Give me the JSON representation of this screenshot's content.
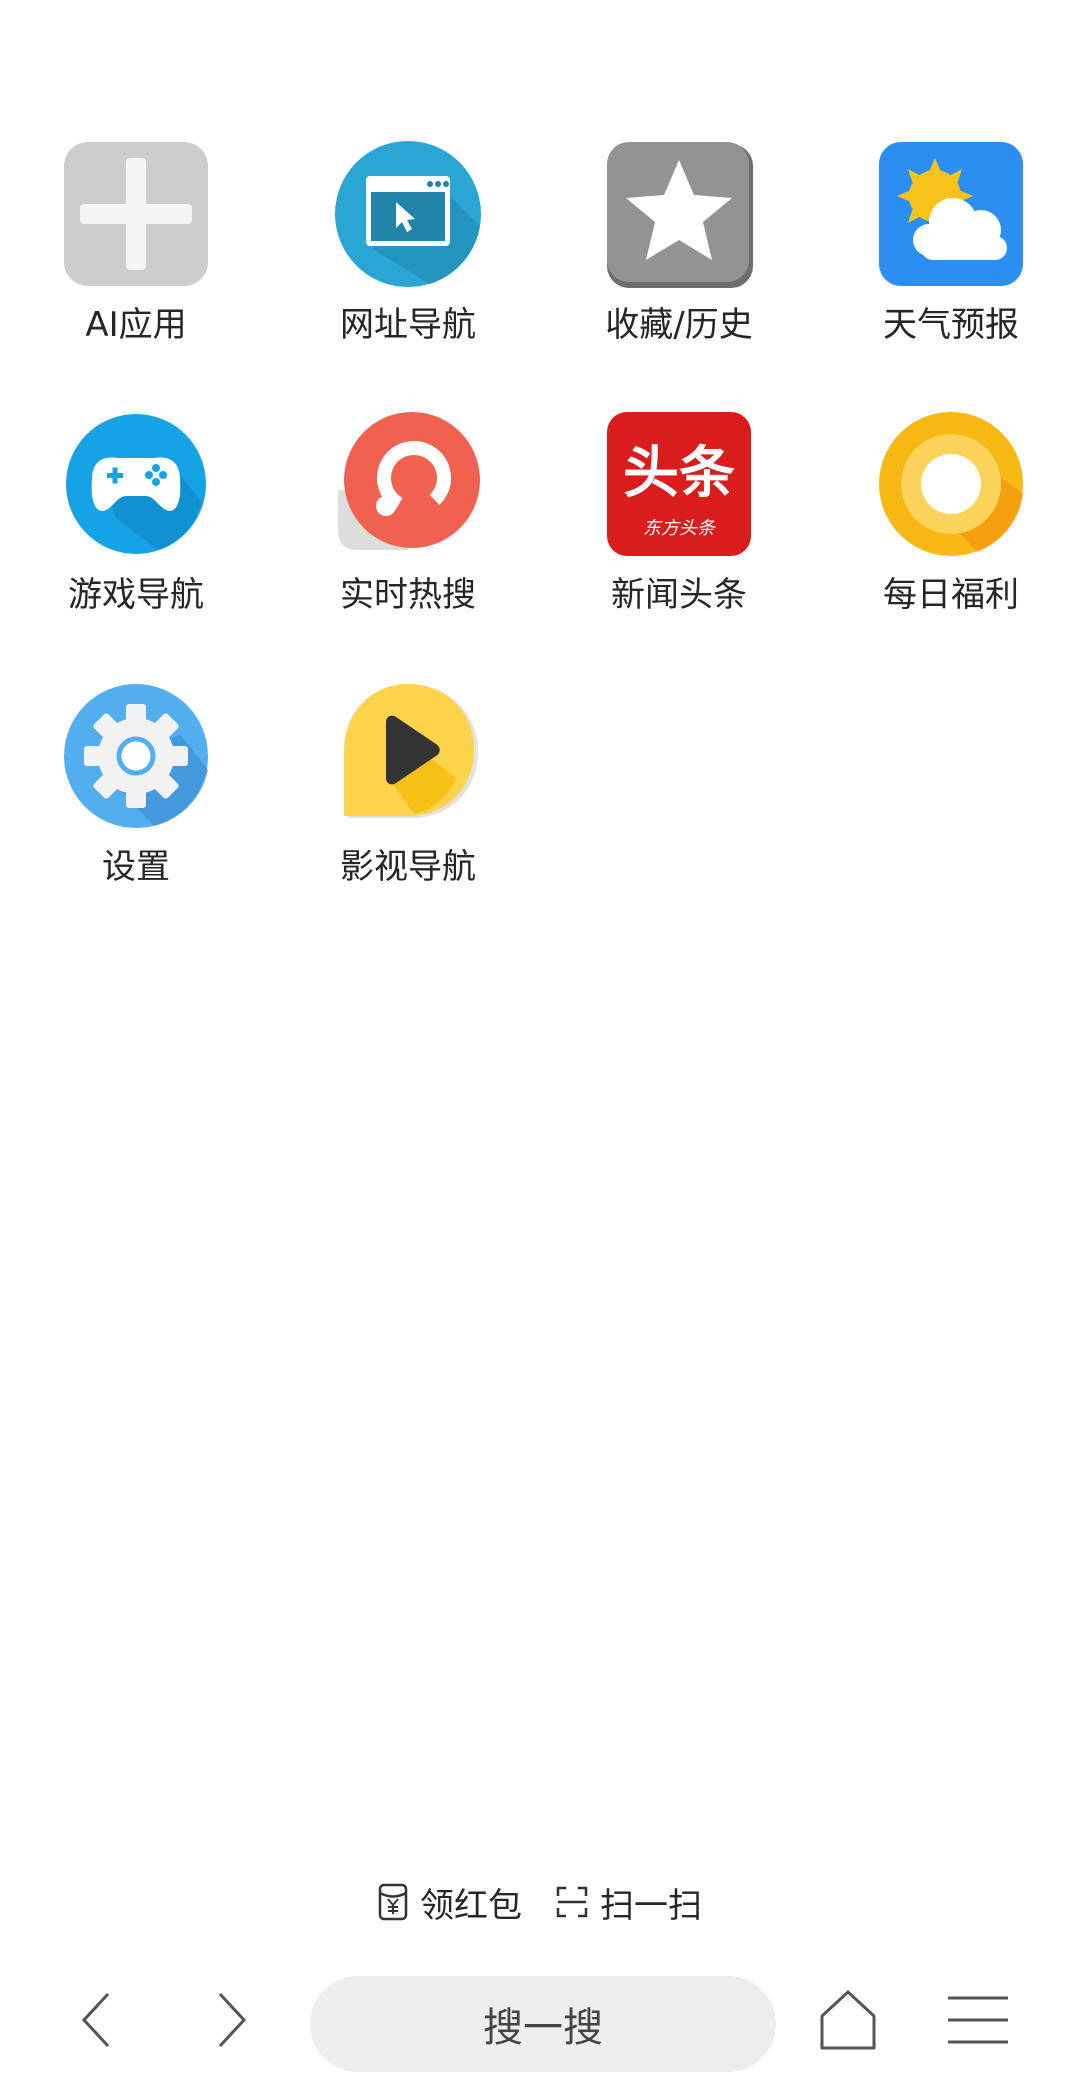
{
  "apps": [
    {
      "label": "AI应用",
      "icon": "plus-icon"
    },
    {
      "label": "网址导航",
      "icon": "browser-window-icon"
    },
    {
      "label": "收藏/历史",
      "icon": "star-icon"
    },
    {
      "label": "天气预报",
      "icon": "weather-icon"
    },
    {
      "label": "游戏导航",
      "icon": "gamepad-icon"
    },
    {
      "label": "实时热搜",
      "icon": "trending-icon"
    },
    {
      "label": "新闻头条",
      "icon": "news-logo-icon",
      "logo_text": "头条",
      "logo_subtext": "东方头条"
    },
    {
      "label": "每日福利",
      "icon": "ring-icon"
    },
    {
      "label": "设置",
      "icon": "gear-icon"
    },
    {
      "label": "影视导航",
      "icon": "play-icon"
    }
  ],
  "quick_links": {
    "red_packet": "领红包",
    "scan": "扫一扫"
  },
  "bottom_bar": {
    "search_label": "搜一搜"
  },
  "colors": {
    "plus_bg": "#cdcdcd",
    "browser_bg": "#2aa6d4",
    "star_bg": "#909090",
    "weather_bg": "#2a8ff0",
    "game_bg": "#16a3e6",
    "trending_bg": "#f0624f",
    "news_bg": "#d91c1c",
    "ring_bg": "#f8b813",
    "gear_bg": "#53aef0",
    "play_bg": "#fcd34a"
  }
}
